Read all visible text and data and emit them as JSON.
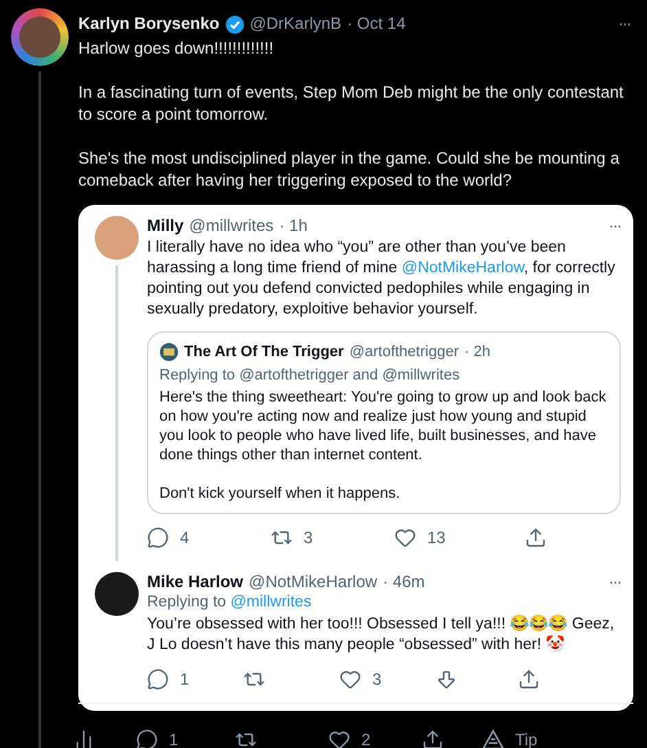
{
  "tweet": {
    "name": "Karlyn Borysenko",
    "handle": "@DrKarlynB",
    "date": "· Oct 14",
    "menu": "···",
    "paragraphs": [
      "Harlow goes down!!!!!!!!!!!!!",
      "In a fascinating turn of events, Step Mom Deb might be the only contestant to score a point tomorrow.",
      "She's the most undisciplined player in the game. Could she be mounting a comeback after having her triggering exposed to the world?"
    ],
    "actions": [
      {
        "kind": "analytics"
      },
      {
        "kind": "reply",
        "count": "1"
      },
      {
        "kind": "retweet"
      },
      {
        "kind": "like",
        "count": "2"
      },
      {
        "kind": "share"
      },
      {
        "kind": "tip",
        "count": "Tip"
      }
    ]
  },
  "replies": [
    {
      "name": "Milly",
      "handle": "@millwrites",
      "date": "· 1h",
      "menu": "···",
      "thread": true,
      "segments": [
        {
          "kind": "text",
          "text": "I literally have no idea who “you” are other than you’ve been harassing a long time friend of mine "
        },
        {
          "kind": "link",
          "text": "@NotMikeHarlow"
        },
        {
          "kind": "text",
          "text": ", for correctly pointing out you defend convicted pedophiles while engaging in sexually predatory, exploitive behavior yourself."
        }
      ],
      "quote": {
        "name": "The Art Of The Trigger",
        "handle": "@artofthetrigger",
        "date": "· 2h",
        "replying": "Replying to @artofthetrigger and @millwrites",
        "paragraphs": [
          "Here's the thing sweetheart: You're going to grow up and look back on how you're acting now and realize just how young and stupid you look to people who have lived life, built businesses, and have done things other than internet content.",
          "Don't kick yourself when it happens."
        ]
      },
      "actions": [
        {
          "kind": "reply",
          "count": "4"
        },
        {
          "kind": "retweet",
          "count": "3"
        },
        {
          "kind": "like",
          "count": "13"
        },
        {
          "kind": "share"
        }
      ]
    },
    {
      "name": "Mike Harlow",
      "handle": "@NotMikeHarlow",
      "date": "· 46m",
      "menu": "···",
      "thread": false,
      "replying_prefix": "Replying to",
      "replying_link": "@millwrites",
      "segments": [
        {
          "kind": "text",
          "text": "You’re obsessed with her too!!! Obsessed I tell ya!!! 😂😂😂 Geez, J Lo doesn’t have this many people “obsessed” with her! 🤡"
        }
      ],
      "actions": [
        {
          "kind": "reply",
          "count": "1"
        },
        {
          "kind": "retweet"
        },
        {
          "kind": "like",
          "count": "3"
        },
        {
          "kind": "download"
        },
        {
          "kind": "share"
        }
      ]
    }
  ]
}
